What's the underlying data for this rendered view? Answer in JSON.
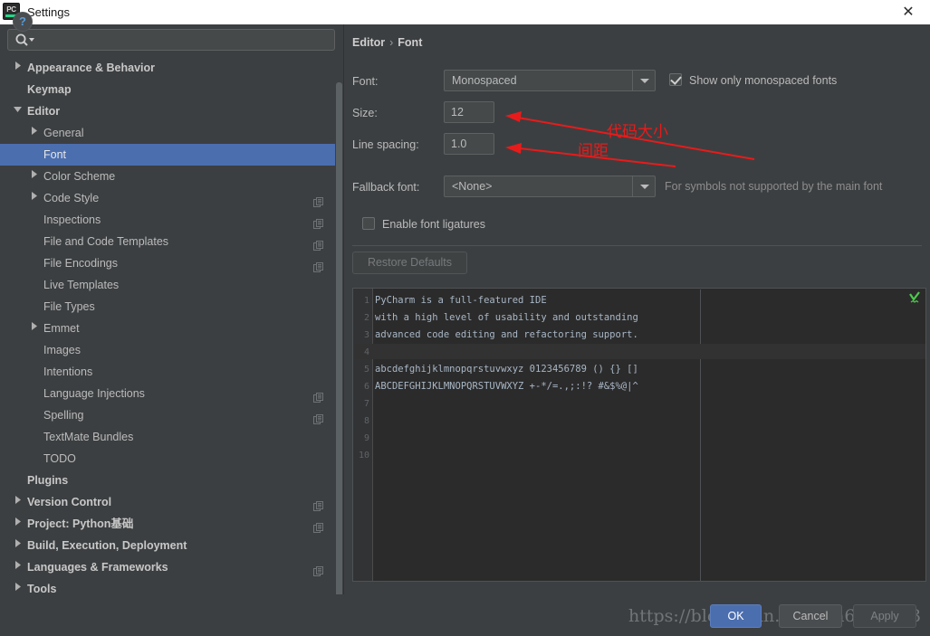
{
  "window": {
    "title": "Settings",
    "logo_icon": "pycharm-logo",
    "logo_text": "PC",
    "close_icon": "close-icon"
  },
  "search": {
    "placeholder": "",
    "value": "",
    "icon": "search-icon"
  },
  "sidebar": {
    "items": [
      {
        "label": "Appearance & Behavior",
        "indent": 30,
        "arrow": "collapsed",
        "bold": true,
        "copy": false,
        "selected": false
      },
      {
        "label": "Keymap",
        "indent": 30,
        "arrow": "none",
        "bold": true,
        "copy": false,
        "selected": false
      },
      {
        "label": "Editor",
        "indent": 30,
        "arrow": "expanded",
        "bold": true,
        "copy": false,
        "selected": false
      },
      {
        "label": "General",
        "indent": 48,
        "arrow": "collapsed",
        "bold": false,
        "copy": false,
        "selected": false
      },
      {
        "label": "Font",
        "indent": 48,
        "arrow": "none",
        "bold": false,
        "copy": false,
        "selected": true
      },
      {
        "label": "Color Scheme",
        "indent": 48,
        "arrow": "collapsed",
        "bold": false,
        "copy": false,
        "selected": false
      },
      {
        "label": "Code Style",
        "indent": 48,
        "arrow": "collapsed",
        "bold": false,
        "copy": true,
        "selected": false
      },
      {
        "label": "Inspections",
        "indent": 48,
        "arrow": "none",
        "bold": false,
        "copy": true,
        "selected": false
      },
      {
        "label": "File and Code Templates",
        "indent": 48,
        "arrow": "none",
        "bold": false,
        "copy": true,
        "selected": false
      },
      {
        "label": "File Encodings",
        "indent": 48,
        "arrow": "none",
        "bold": false,
        "copy": true,
        "selected": false
      },
      {
        "label": "Live Templates",
        "indent": 48,
        "arrow": "none",
        "bold": false,
        "copy": false,
        "selected": false
      },
      {
        "label": "File Types",
        "indent": 48,
        "arrow": "none",
        "bold": false,
        "copy": false,
        "selected": false
      },
      {
        "label": "Emmet",
        "indent": 48,
        "arrow": "collapsed",
        "bold": false,
        "copy": false,
        "selected": false
      },
      {
        "label": "Images",
        "indent": 48,
        "arrow": "none",
        "bold": false,
        "copy": false,
        "selected": false
      },
      {
        "label": "Intentions",
        "indent": 48,
        "arrow": "none",
        "bold": false,
        "copy": false,
        "selected": false
      },
      {
        "label": "Language Injections",
        "indent": 48,
        "arrow": "none",
        "bold": false,
        "copy": true,
        "selected": false
      },
      {
        "label": "Spelling",
        "indent": 48,
        "arrow": "none",
        "bold": false,
        "copy": true,
        "selected": false
      },
      {
        "label": "TextMate Bundles",
        "indent": 48,
        "arrow": "none",
        "bold": false,
        "copy": false,
        "selected": false
      },
      {
        "label": "TODO",
        "indent": 48,
        "arrow": "none",
        "bold": false,
        "copy": false,
        "selected": false
      },
      {
        "label": "Plugins",
        "indent": 30,
        "arrow": "none",
        "bold": true,
        "copy": false,
        "selected": false
      },
      {
        "label": "Version Control",
        "indent": 30,
        "arrow": "collapsed",
        "bold": true,
        "copy": true,
        "selected": false
      },
      {
        "label": "Project: Python基础",
        "indent": 30,
        "arrow": "collapsed",
        "bold": true,
        "copy": true,
        "selected": false
      },
      {
        "label": "Build, Execution, Deployment",
        "indent": 30,
        "arrow": "collapsed",
        "bold": true,
        "copy": false,
        "selected": false
      },
      {
        "label": "Languages & Frameworks",
        "indent": 30,
        "arrow": "collapsed",
        "bold": true,
        "copy": true,
        "selected": false
      },
      {
        "label": "Tools",
        "indent": 30,
        "arrow": "collapsed",
        "bold": true,
        "copy": false,
        "selected": false
      }
    ]
  },
  "main": {
    "breadcrumb": {
      "root": "Editor",
      "separator": "›",
      "leaf": "Font"
    },
    "font_label": "Font:",
    "font_value": "Monospaced",
    "show_monospaced_label": "Show only monospaced fonts",
    "show_monospaced_checked": true,
    "size_label": "Size:",
    "size_value": "12",
    "line_spacing_label": "Line spacing:",
    "line_spacing_value": "1.0",
    "fallback_label": "Fallback font:",
    "fallback_value": "<None>",
    "fallback_hint": "For symbols not supported by the main font",
    "ligatures_label": "Enable font ligatures",
    "ligatures_checked": false,
    "restore_defaults_label": "Restore Defaults"
  },
  "preview": {
    "line_numbers": [
      "1",
      "2",
      "3",
      "4",
      "5",
      "6",
      "7",
      "8",
      "9",
      "10"
    ],
    "lines": [
      "PyCharm is a full-featured IDE",
      "with a high level of usability and outstanding",
      "advanced code editing and refactoring support.",
      "",
      "abcdefghijklmnopqrstuvwxyz 0123456789 () {} []",
      "ABCDEFGHIJKLMNOPQRSTUVWXYZ +-*/=.,;:!? #&$%@|^"
    ],
    "caret_line": 4,
    "inspection_icon": "inspection-ok-icon"
  },
  "annotations": {
    "size_note": "代码大小",
    "spacing_note": "间距",
    "color": "#e81b1b"
  },
  "footer": {
    "help_icon": "help-icon",
    "help_label": "?",
    "ok_label": "OK",
    "cancel_label": "Cancel",
    "apply_label": "Apply",
    "watermark": "https://blog.csdn.net/zha6476003"
  }
}
